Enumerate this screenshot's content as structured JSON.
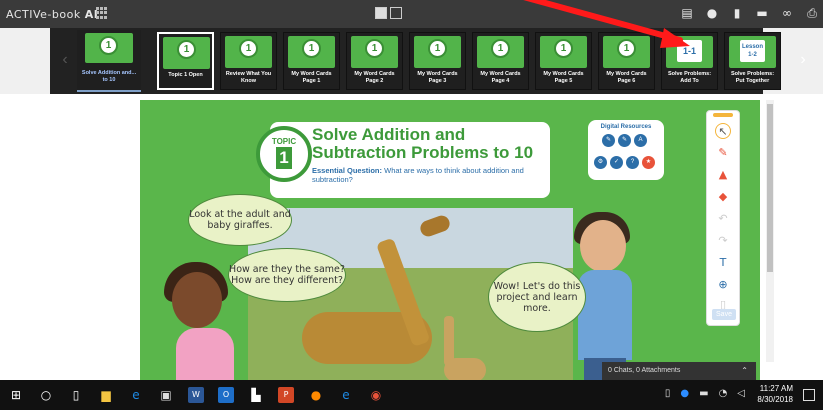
{
  "app": {
    "title": "ACTIVe-book",
    "title_suffix": "AI"
  },
  "toolbar_top": {
    "icons": [
      "notes-icon",
      "chat-icon",
      "bookmark-icon",
      "folder-icon",
      "link-icon",
      "print-icon"
    ]
  },
  "thumbs": [
    {
      "label": "Solve Addition and... to 10",
      "kind": "topic",
      "badge": "1"
    },
    {
      "label": "Topic 1 Open",
      "kind": "topic",
      "badge": "1"
    },
    {
      "label": "Review What You Know",
      "kind": "topic",
      "badge": "1"
    },
    {
      "label": "My Word Cards Page 1",
      "kind": "topic",
      "badge": "1"
    },
    {
      "label": "My Word Cards Page 2",
      "kind": "topic",
      "badge": "1"
    },
    {
      "label": "My Word Cards Page 3",
      "kind": "topic",
      "badge": "1"
    },
    {
      "label": "My Word Cards Page 4",
      "kind": "topic",
      "badge": "1"
    },
    {
      "label": "My Word Cards Page 5",
      "kind": "topic",
      "badge": "1"
    },
    {
      "label": "My Word Cards Page 6",
      "kind": "topic",
      "badge": "1"
    },
    {
      "label": "Solve Problems: Add To",
      "kind": "lesson",
      "badge": "1-1"
    },
    {
      "label": "Solve Problems: Put Together",
      "kind": "lesson",
      "badge": "Lesson 1-2"
    }
  ],
  "page": {
    "topic_word": "TOPIC",
    "topic_number": "1",
    "title": "Solve Addition and Subtraction Problems to 10",
    "eq_label": "Essential Question:",
    "eq_text": "What are ways to think about addition and subtraction?",
    "digital_title": "Digital Resources",
    "digital_row1": [
      "Solve",
      "Learn",
      "Glossary"
    ],
    "digital_row2": [
      "Tools",
      "Assessment",
      "Help",
      "Games"
    ],
    "bubble1": "Look at the adult and baby giraffes.",
    "bubble2": "How are they the same? How are they different?",
    "bubble3": "Wow! Let's do this project and learn more."
  },
  "side_tools": {
    "items": [
      "pointer-icon",
      "pen-icon",
      "highlighter-icon",
      "eraser-icon",
      "undo-icon",
      "redo-icon",
      "text-icon",
      "zoom-icon",
      "trash-icon"
    ],
    "save": "Save"
  },
  "chatbar": {
    "text": "0 Chats, 0 Attachments"
  },
  "taskbar": {
    "time": "11:27 AM",
    "date": "8/30/2018"
  },
  "colors": {
    "accent_green": "#5ab64b",
    "dark_green": "#3d9a3a",
    "blue": "#2c6ea8",
    "arrow_red": "#ff1a1a"
  }
}
